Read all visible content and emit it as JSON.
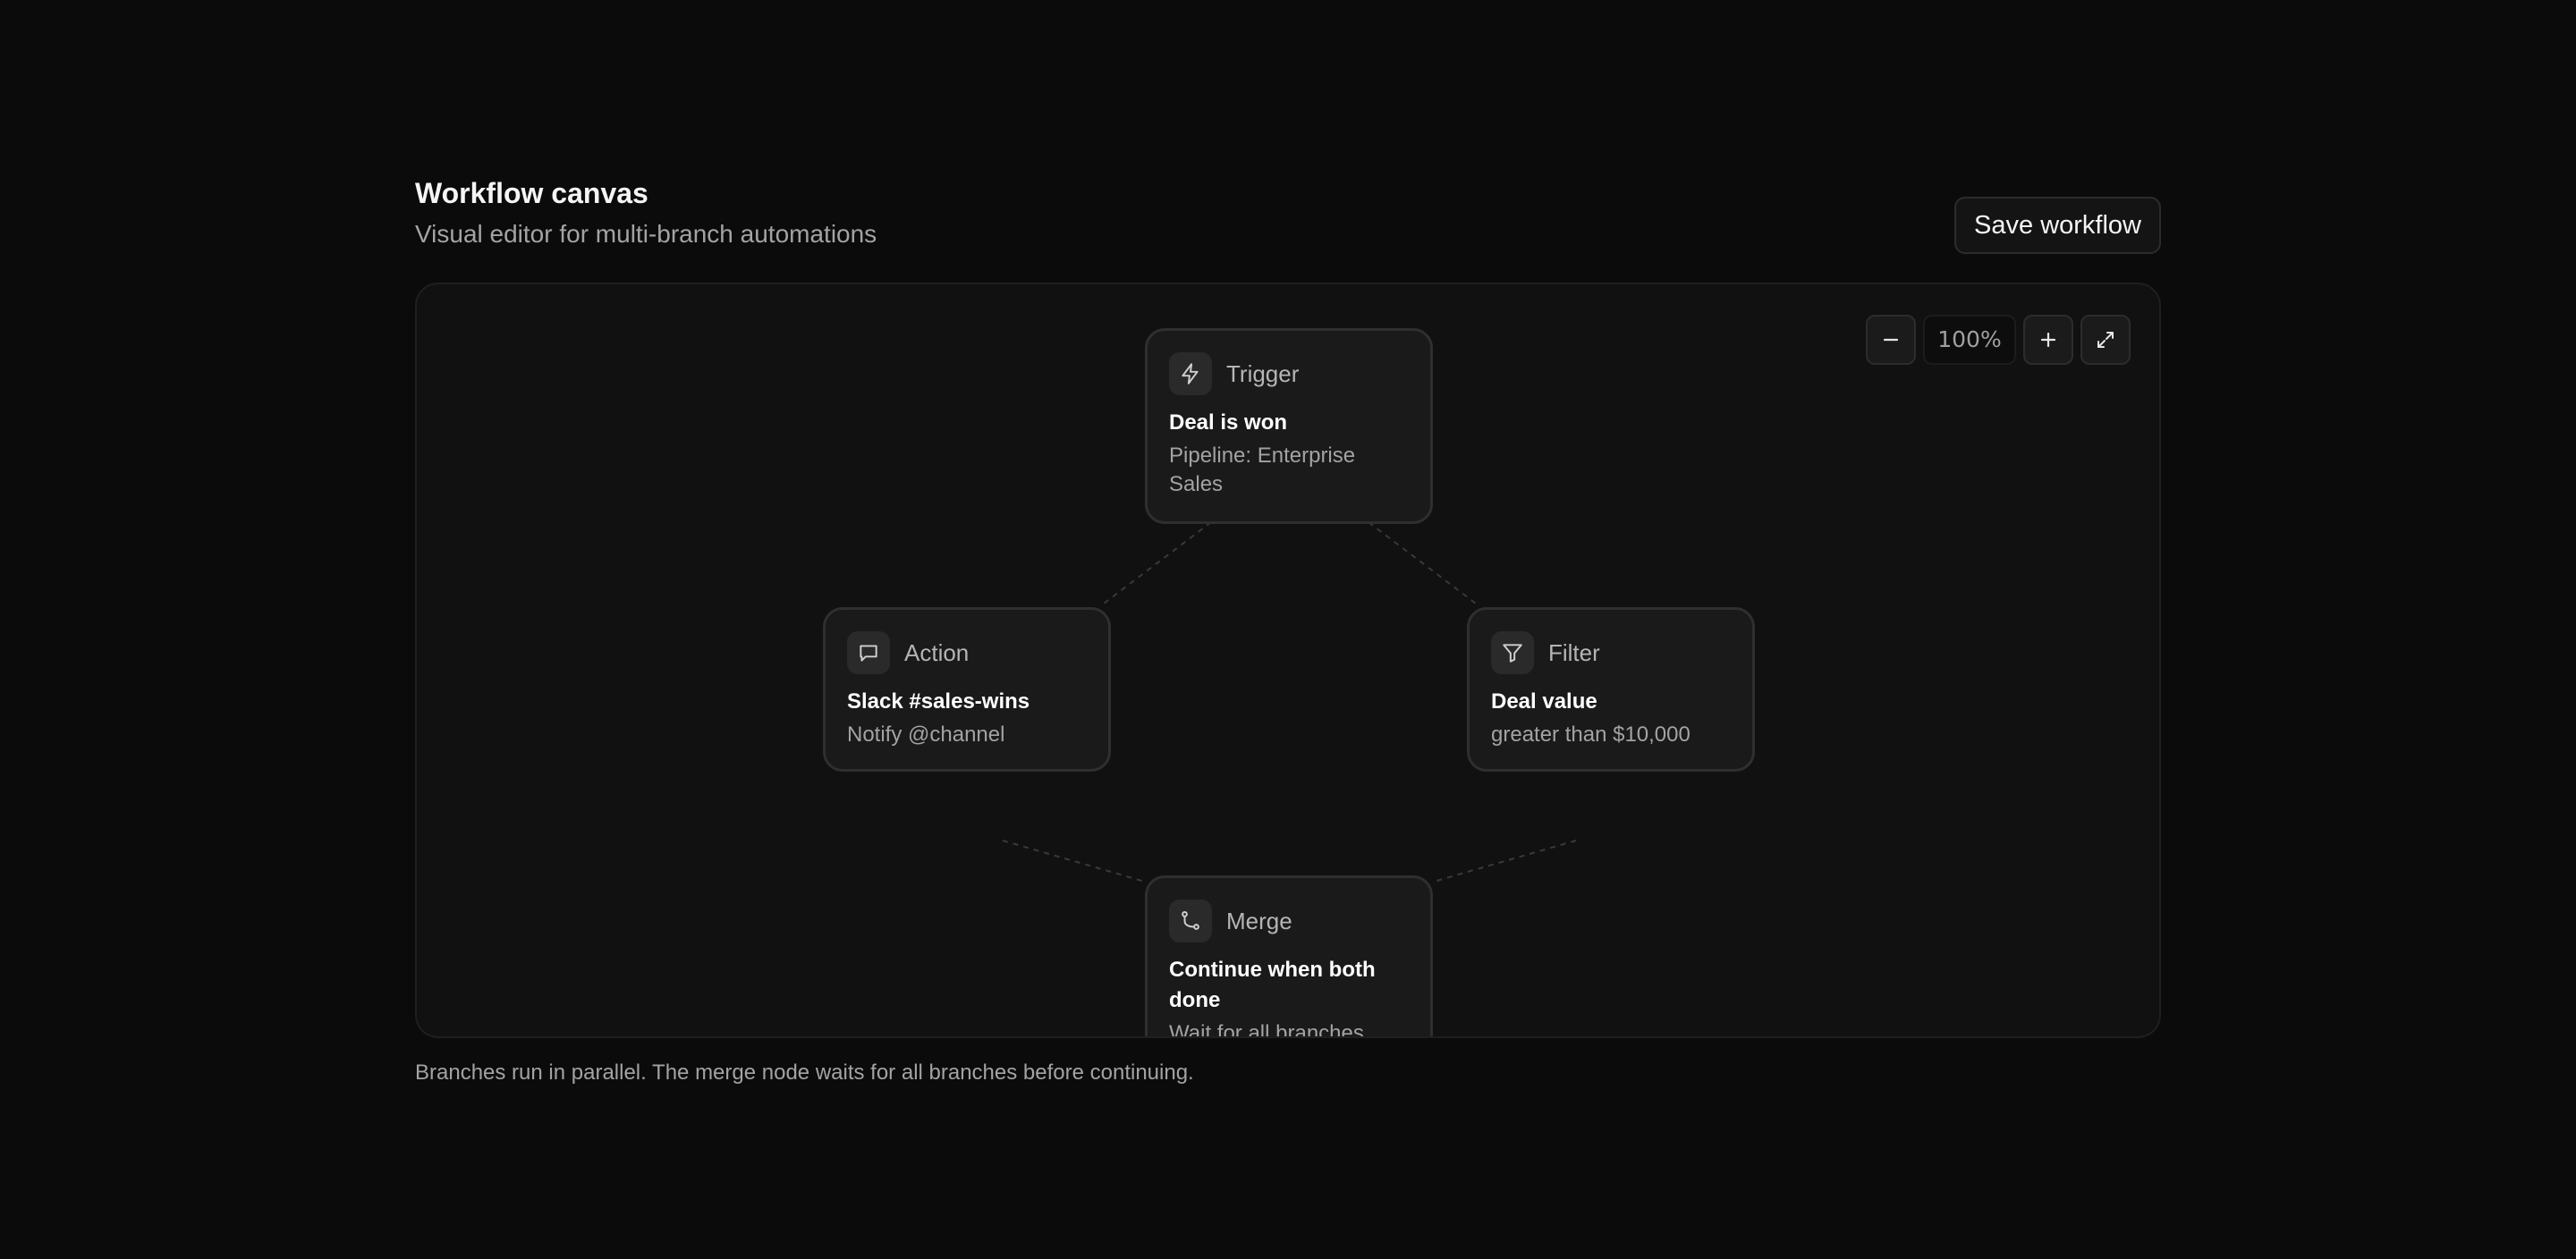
{
  "header": {
    "title": "Workflow canvas",
    "subtitle": "Visual editor for multi-branch automations",
    "save_label": "Save workflow"
  },
  "zoom": {
    "level": "100%",
    "zoom_out_icon": "minus-icon",
    "zoom_in_icon": "plus-icon",
    "fullscreen_icon": "expand-icon"
  },
  "nodes": {
    "trigger": {
      "type": "Trigger",
      "title": "Deal is won",
      "desc": "Pipeline: Enterprise Sales",
      "icon": "lightning-icon"
    },
    "action": {
      "type": "Action",
      "title": "Slack #sales-wins",
      "desc": "Notify @channel",
      "icon": "message-icon"
    },
    "filter": {
      "type": "Filter",
      "title": "Deal value",
      "desc": "greater than $10,000",
      "icon": "filter-icon"
    },
    "merge": {
      "type": "Merge",
      "title": "Continue when both done",
      "desc": "Wait for all branches",
      "icon": "merge-icon"
    }
  },
  "footnote": "Branches run in parallel. The merge node waits for all branches before continuing.",
  "colors": {
    "background": "#0b0b0b",
    "canvas": "#111111",
    "node": "#1a1a1a",
    "border": "#2f2f2f",
    "muted_text": "#a3a3a3"
  }
}
